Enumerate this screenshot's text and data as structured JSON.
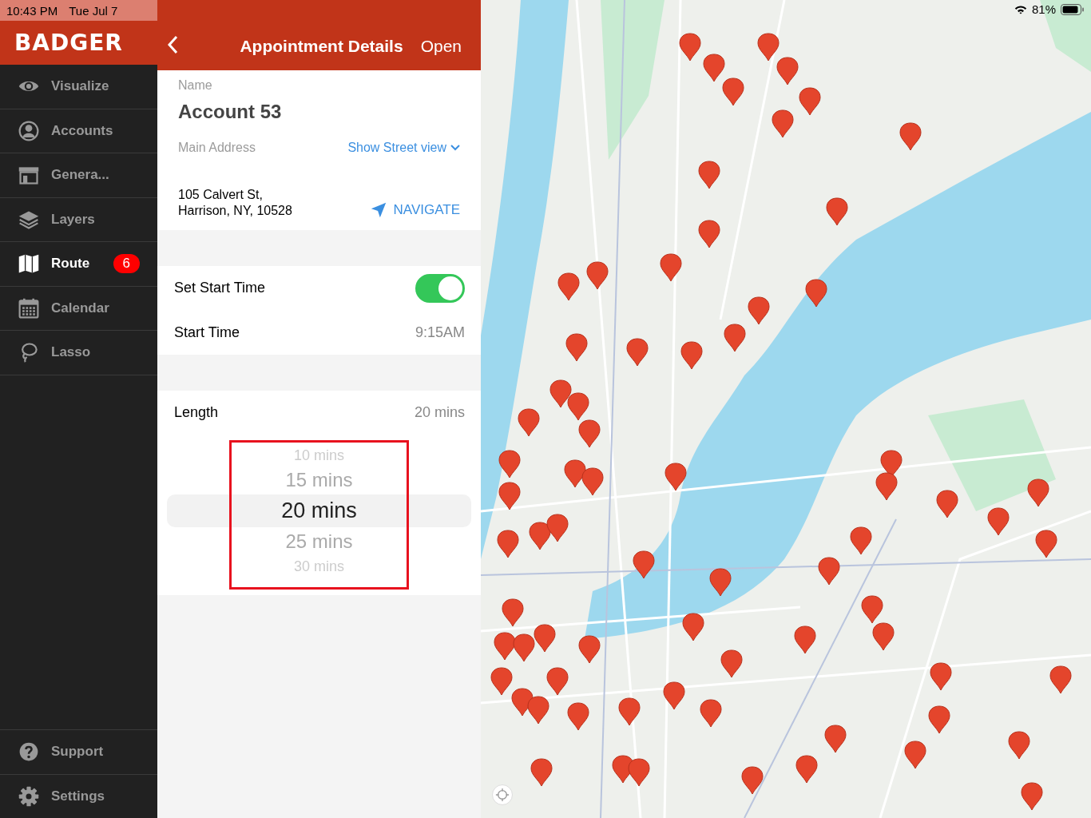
{
  "status_bar": {
    "time": "10:43 PM",
    "date": "Tue Jul 7",
    "battery": "81%"
  },
  "sidebar": {
    "logo": "BADGER",
    "items": [
      {
        "label": "Visualize",
        "selected": false
      },
      {
        "label": "Accounts",
        "selected": false
      },
      {
        "label": "Genera...",
        "selected": false
      },
      {
        "label": "Layers",
        "selected": false
      },
      {
        "label": "Route",
        "selected": true,
        "badge": "6"
      },
      {
        "label": "Calendar",
        "selected": false
      },
      {
        "label": "Lasso",
        "selected": false
      }
    ],
    "footer_items": [
      {
        "label": "Support"
      },
      {
        "label": "Settings"
      }
    ]
  },
  "header": {
    "title": "Appointment Details",
    "action": "Open"
  },
  "details": {
    "name_label": "Name",
    "name": "Account 53",
    "address_label": "Main Address",
    "street_view_link": "Show Street view",
    "address_lines": [
      "105 Calvert St,",
      "Harrison, NY, 10528"
    ],
    "navigate": "NAVIGATE"
  },
  "start_time": {
    "toggle_label": "Set Start Time",
    "on": true,
    "label": "Start Time",
    "value": "9:15AM"
  },
  "length": {
    "label": "Length",
    "value": "20 mins",
    "options": [
      {
        "label": "10 mins",
        "selected": false
      },
      {
        "label": "15 mins",
        "selected": false
      },
      {
        "label": "20 mins",
        "selected": true
      },
      {
        "label": "25 mins",
        "selected": false
      },
      {
        "label": "30 mins",
        "selected": false
      }
    ]
  }
}
